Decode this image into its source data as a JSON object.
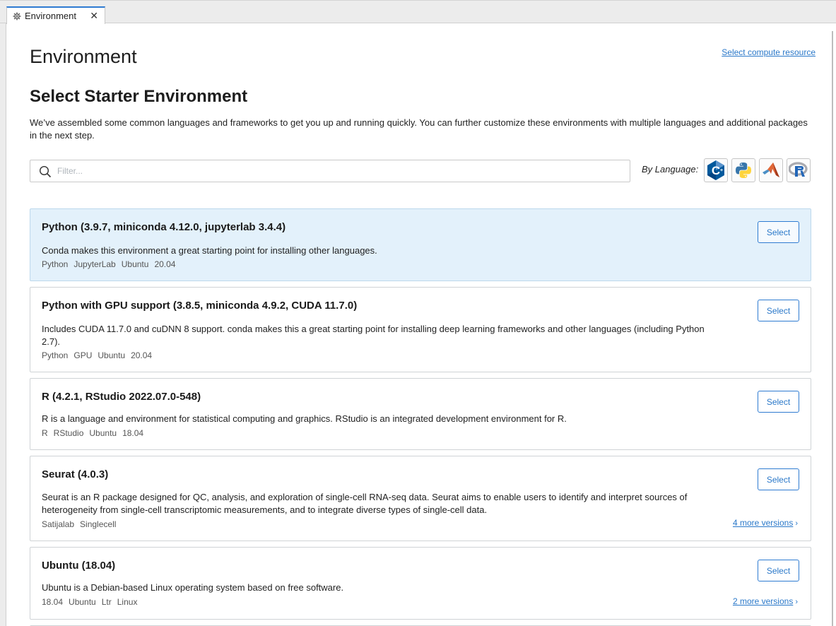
{
  "tab": {
    "label": "Environment",
    "close": "✕"
  },
  "page": {
    "title": "Environment",
    "compute_link": "Select compute resource",
    "section_title": "Select Starter Environment",
    "intro": "We’ve assembled some common languages and frameworks to get you up and running quickly. You can further customize these environments with multiple languages and additional packages in the next step."
  },
  "filter": {
    "placeholder": "Filter...",
    "value": ""
  },
  "by_language": {
    "label": "By Language:",
    "languages": [
      {
        "name": "C++",
        "icon": "cpp-icon"
      },
      {
        "name": "Python",
        "icon": "python-icon"
      },
      {
        "name": "MATLAB",
        "icon": "matlab-icon"
      },
      {
        "name": "R",
        "icon": "r-icon"
      }
    ]
  },
  "colors": {
    "accent": "#2e7bd1",
    "selected_bg": "#e3f1fb",
    "link": "#2a78c9"
  },
  "environments": [
    {
      "title": "Python (3.9.7, miniconda 4.12.0, jupyterlab 3.4.4)",
      "description": "Conda makes this environment a great starting point for installing other languages.",
      "tags": [
        "Python",
        "JupyterLab",
        "Ubuntu",
        "20.04"
      ],
      "button": "Select",
      "more": "",
      "selected": true
    },
    {
      "title": "Python with GPU support (3.8.5, miniconda 4.9.2, CUDA 11.7.0)",
      "description": "Includes CUDA 11.7.0 and cuDNN 8 support. conda makes this a great starting point for installing deep learning frameworks and other languages (including Python 2.7).",
      "tags": [
        "Python",
        "GPU",
        "Ubuntu",
        "20.04"
      ],
      "button": "Select",
      "more": ""
    },
    {
      "title": "R (4.2.1, RStudio 2022.07.0-548)",
      "description": "R is a language and environment for statistical computing and graphics. RStudio is an integrated development environment for R.",
      "tags": [
        "R",
        "RStudio",
        "Ubuntu",
        "18.04"
      ],
      "button": "Select",
      "more": ""
    },
    {
      "title": "Seurat (4.0.3)",
      "description": "Seurat is an R package designed for QC, analysis, and exploration of single-cell RNA-seq data. Seurat aims to enable users to identify and interpret sources of heterogeneity from single-cell transcriptomic measurements, and to integrate diverse types of single-cell data.",
      "tags": [
        "Satijalab",
        "Singlecell"
      ],
      "button": "Select",
      "more": "4 more versions"
    },
    {
      "title": "Ubuntu (18.04)",
      "description": "Ubuntu is a Debian-based Linux operating system based on free software.",
      "tags": [
        "18.04",
        "Ubuntu",
        "Ltr",
        "Linux"
      ],
      "button": "Select",
      "more": "2 more versions"
    }
  ]
}
